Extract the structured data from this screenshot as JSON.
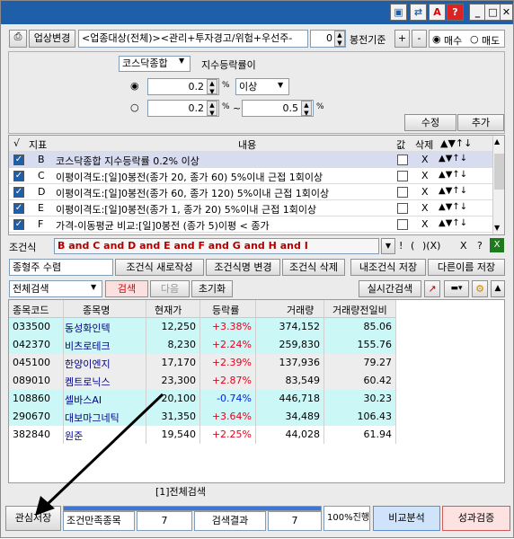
{
  "toolbar": {
    "sector_change_label": "업상변경",
    "sector_filter": "<업종대상(전체)><관리+투자경고/위험+우선주-",
    "bar_count": "0",
    "bar_basis_label": "봉전기준",
    "plus": "+",
    "minus": "-",
    "buy_label": "매수",
    "sell_label": "매도"
  },
  "index_panel": {
    "index_select": "코스닥종합",
    "rate_label": "지수등락률이",
    "value1": "0.2",
    "unit1": "%",
    "compare_select": "이상",
    "value2": "0.2",
    "unit2": "%",
    "tilde": "~",
    "value3": "0.5",
    "unit3": "%",
    "edit_label": "수정",
    "add_label": "추가"
  },
  "conditions": {
    "headers": {
      "check": "√",
      "index": "지표",
      "content": "내용",
      "value": "값",
      "delete": "삭제",
      "move": "▲▼↑↓"
    },
    "rows": [
      {
        "key": "B",
        "text": "코스닥종합 지수등락률 0.2% 이상",
        "del": "X"
      },
      {
        "key": "C",
        "text": "이평이격도:[일]0봉전(종가 20, 종가 60) 5%이내 근접 1회이상",
        "del": "X"
      },
      {
        "key": "D",
        "text": "이평이격도:[일]0봉전(종가 60, 종가 120) 5%이내 근접 1회이상",
        "del": "X"
      },
      {
        "key": "E",
        "text": "이평이격도:[일]0봉전(종가 1, 종가 20) 5%이내 근접 1회이상",
        "del": "X"
      },
      {
        "key": "F",
        "text": "가격-이동평균 비교:[일]0봉전 (종가 5)이평 < 종가",
        "del": "X"
      }
    ]
  },
  "formula": {
    "label": "조건식",
    "text": "B and C and D and E and F and G and H and I",
    "sym1": "!",
    "sym2": "(",
    "sym3": ")(X)",
    "sym4": "X",
    "sym5": "?"
  },
  "actions": {
    "name_value": "종형주 수렴",
    "new_label": "조건식 새로작성",
    "rename_label": "조건식명 변경",
    "delete_label": "조건식 삭제",
    "my_save_label": "내조건식 저장",
    "save_as_label": "다른이름 저장"
  },
  "search_bar": {
    "scope_select": "전체검색",
    "search_label": "검색",
    "next_label": "다음",
    "reset_label": "초기화",
    "realtime_label": "실시간검색"
  },
  "results": {
    "headers": [
      "종목코드",
      "종목명",
      "현재가",
      "등락률",
      "거래량",
      "거래량전일비"
    ],
    "rows": [
      {
        "code": "033500",
        "name": "동성화인텍",
        "price": "12,250",
        "rate": "+3.38%",
        "volume": "374,152",
        "ratio": "85.06",
        "bg": "#ccf7f7"
      },
      {
        "code": "042370",
        "name": "비츠로테크",
        "price": "8,230",
        "rate": "+2.24%",
        "volume": "259,830",
        "ratio": "155.76",
        "bg": "#ccf7f7"
      },
      {
        "code": "045100",
        "name": "한양이엔지",
        "price": "17,170",
        "rate": "+2.39%",
        "volume": "137,936",
        "ratio": "79.27",
        "bg": "#ededed"
      },
      {
        "code": "089010",
        "name": "켐트로닉스",
        "price": "23,300",
        "rate": "+2.87%",
        "volume": "83,549",
        "ratio": "60.42",
        "bg": "#ededed"
      },
      {
        "code": "108860",
        "name": "셀바스AI",
        "price": "20,100",
        "rate": "-0.74%",
        "volume": "446,718",
        "ratio": "30.23",
        "bg": "#ccf7f7"
      },
      {
        "code": "290670",
        "name": "대보마그네틱",
        "price": "31,350",
        "rate": "+3.64%",
        "volume": "34,489",
        "ratio": "106.43",
        "bg": "#ccf7f7"
      },
      {
        "code": "382840",
        "name": "원준",
        "price": "19,540",
        "rate": "+2.25%",
        "volume": "44,028",
        "ratio": "61.94",
        "bg": "#ffffff"
      }
    ]
  },
  "tab": {
    "label": "[1]전체검색"
  },
  "status": {
    "watch_save": "관심저장",
    "match_label": "조건만족종목",
    "match_count": "7",
    "result_label": "검색결과",
    "result_count": "7",
    "progress": "100%진행",
    "progress_value": 1.0,
    "compare_label": "비교분석",
    "perf_label": "성과검증"
  },
  "colors": {
    "up": "#e8001c",
    "down": "#0026d8",
    "title": "#1f5ea8"
  }
}
